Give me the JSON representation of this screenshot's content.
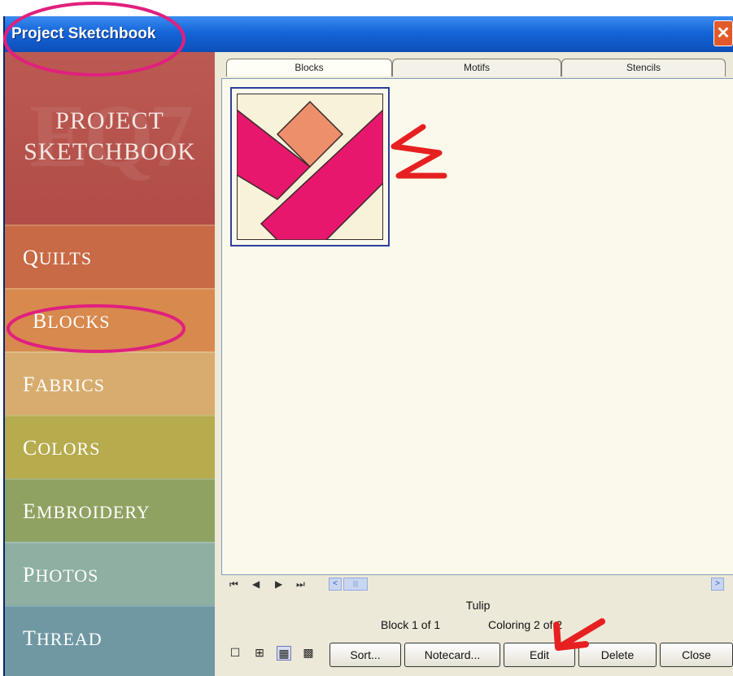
{
  "window": {
    "title": "Project Sketchbook",
    "close_glyph": "✕"
  },
  "nav": {
    "title_line1": "PROJECT",
    "title_line2": "SKETCHBOOK",
    "logo_mark": "EQ7",
    "items": [
      {
        "label": "Quilts"
      },
      {
        "label": "Blocks"
      },
      {
        "label": "Fabrics"
      },
      {
        "label": "Colors"
      },
      {
        "label": "Embroidery"
      },
      {
        "label": "Photos"
      },
      {
        "label": "Thread"
      }
    ]
  },
  "tabs": [
    {
      "label": "Blocks",
      "selected": true
    },
    {
      "label": "Motifs",
      "selected": false
    },
    {
      "label": "Stencils",
      "selected": false
    }
  ],
  "tab_dropdown_glyph": "▾",
  "content": {
    "block": {
      "name": "Tulip",
      "colors": {
        "background": "#f8f2d8",
        "petal": "#e8176e",
        "center": "#ee8f6b",
        "outline": "#3a2a2a"
      }
    }
  },
  "record_nav": {
    "first": "⏮",
    "prev": "◀",
    "next": "▶",
    "last": "⏭",
    "scroll_left": "<",
    "scroll_right": ">",
    "thumb": "|||"
  },
  "status": {
    "name": "Tulip",
    "block": "Block 1 of 1",
    "coloring": "Coloring 2 of 2"
  },
  "view_icons": [
    "☐",
    "⊞",
    "▦",
    "▩"
  ],
  "buttons": {
    "sort": "Sort...",
    "notecard": "Notecard...",
    "edit": "Edit",
    "delete": "Delete",
    "close": "Close"
  },
  "annotation_colors": {
    "circle": "#e0207e",
    "arrow": "#e62020"
  }
}
